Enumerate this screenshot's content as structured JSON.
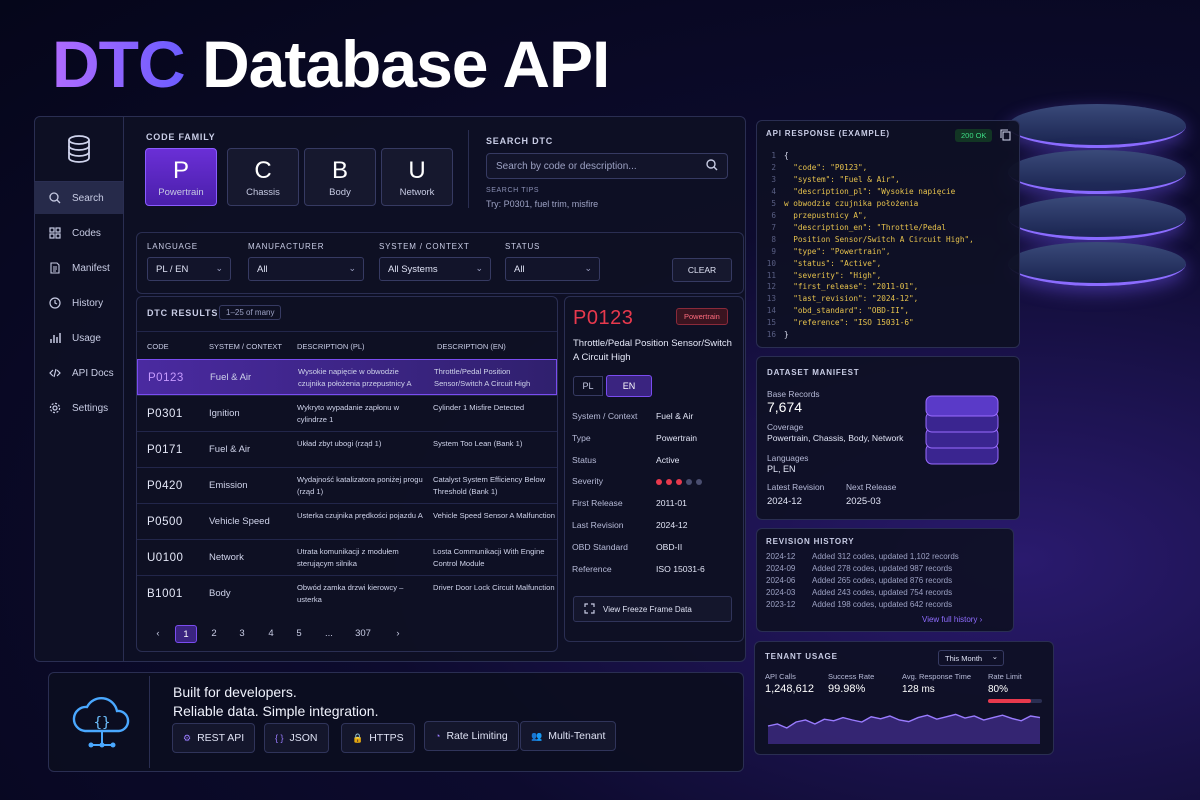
{
  "title": {
    "accent": "DTC",
    "rest": "Database API"
  },
  "colors": {
    "accent": "#7c4dff",
    "code_highlight": "#e8394d",
    "json": "#e6c24d",
    "ok": "#3ddc84"
  },
  "sidebar": {
    "logo_icon": "database-icon",
    "items": [
      {
        "label": "Search",
        "icon": "search-icon"
      },
      {
        "label": "Codes",
        "icon": "grid-icon"
      },
      {
        "label": "Manifest",
        "icon": "document-icon"
      },
      {
        "label": "History",
        "icon": "clock-icon"
      },
      {
        "label": "Usage",
        "icon": "bar-chart-icon"
      },
      {
        "label": "API Docs",
        "icon": "code-icon"
      },
      {
        "label": "Settings",
        "icon": "gear-icon"
      }
    ]
  },
  "code_family": {
    "label": "CODE FAMILY",
    "buttons": [
      {
        "letter": "P",
        "name": "Powertrain"
      },
      {
        "letter": "C",
        "name": "Chassis"
      },
      {
        "letter": "B",
        "name": "Body"
      },
      {
        "letter": "U",
        "name": "Network"
      }
    ]
  },
  "search": {
    "label": "SEARCH DTC",
    "placeholder": "Search by code or description...",
    "tips_label": "SEARCH TIPS",
    "tips": "Try: P0301, fuel trim, misfire"
  },
  "filters": {
    "language": {
      "label": "LANGUAGE",
      "value": "PL / EN"
    },
    "manufacturer": {
      "label": "MANUFACTURER",
      "value": "All"
    },
    "system": {
      "label": "SYSTEM / CONTEXT",
      "value": "All Systems"
    },
    "status": {
      "label": "STATUS",
      "value": "All"
    },
    "clear": "CLEAR"
  },
  "results": {
    "title": "DTC RESULTS",
    "count": "1–25 of many",
    "columns": [
      "CODE",
      "SYSTEM / CONTEXT",
      "DESCRIPTION (PL)",
      "DESCRIPTION (EN)"
    ],
    "rows": [
      {
        "code": "P0123",
        "system": "Fuel & Air",
        "pl": "Wysokie napięcie w obwodzie czujnika położenia przepustnicy A",
        "en": "Throttle/Pedal Position Sensor/Switch A Circuit High"
      },
      {
        "code": "P0301",
        "system": "Ignition",
        "pl": "Wykryto wypadanie zapłonu w cylindrze 1",
        "en": "Cylinder 1 Misfire Detected"
      },
      {
        "code": "P0171",
        "system": "Fuel & Air",
        "pl": "Układ zbyt ubogi (rząd 1)",
        "en": "System Too Lean (Bank 1)"
      },
      {
        "code": "P0420",
        "system": "Emission",
        "pl": "Wydajność katalizatora poniżej progu (rząd 1)",
        "en": "Catalyst System Efficiency Below Threshold (Bank 1)"
      },
      {
        "code": "P0500",
        "system": "Vehicle Speed",
        "pl": "Usterka czujnika prędkości pojazdu A",
        "en": "Vehicle Speed Sensor A Malfunction"
      },
      {
        "code": "U0100",
        "system": "Network",
        "pl": "Utrata komunikacji z modułem sterującym silnika",
        "en": "Losta Communikacji With Engine Control Module"
      },
      {
        "code": "B1001",
        "system": "Body",
        "pl": "Obwód zamka drzwi kierowcy – usterka",
        "en": "Driver Door Lock Circuit Malfunction"
      }
    ],
    "pagination": {
      "prev": "‹",
      "pages": [
        "1",
        "2",
        "3",
        "4",
        "5",
        "...",
        "307"
      ],
      "next": "›",
      "current": "1"
    }
  },
  "detail": {
    "code": "P0123",
    "badge": "Powertrain",
    "title": "Throttle/Pedal Position Sensor/Switch A Circuit High",
    "lang_tabs": [
      "PL",
      "EN"
    ],
    "fields": [
      {
        "k": "System / Context",
        "v": "Fuel & Air"
      },
      {
        "k": "Type",
        "v": "Powertrain"
      },
      {
        "k": "Status",
        "v": "Active"
      },
      {
        "k": "Severity",
        "v": ""
      },
      {
        "k": "First Release",
        "v": "2011-01"
      },
      {
        "k": "Last Revision",
        "v": "2024-12"
      },
      {
        "k": "OBD Standard",
        "v": "OBD-II"
      },
      {
        "k": "Reference",
        "v": "ISO 15031-6"
      }
    ],
    "severity_level": 3,
    "severity_max": 5,
    "freeze_button": "View Freeze Frame Data"
  },
  "api_response": {
    "label": "API RESPONSE (EXAMPLE)",
    "status": "200 OK",
    "lines": [
      "{",
      "  \"code\": \"P0123\",",
      "  \"system\": \"Fuel & Air\",",
      "  \"description_pl\": \"Wysokie napięcie",
      "w obwodzie czujnika położenia",
      "  przepustnicy A\",",
      "  \"description_en\": \"Throttle/Pedal",
      "  Position Sensor/Switch A Circuit High\",",
      "  \"type\": \"Powertrain\",",
      "  \"status\": \"Active\",",
      "  \"severity\": \"High\",",
      "  \"first_release\": \"2011-01\",",
      "  \"last_revision\": \"2024-12\",",
      "  \"obd_standard\": \"OBD-II\",",
      "  \"reference\": \"ISO 15031-6\"",
      "}"
    ]
  },
  "manifest": {
    "label": "DATASET MANIFEST",
    "base_records_label": "Base Records",
    "base_records": "7,674",
    "coverage_label": "Coverage",
    "coverage": "Powertrain, Chassis, Body, Network",
    "languages_label": "Languages",
    "languages": "PL, EN",
    "latest_label": "Latest Revision",
    "latest": "2024-12",
    "next_label": "Next Release",
    "next": "2025-03"
  },
  "revision_history": {
    "label": "REVISION HISTORY",
    "items": [
      {
        "date": "2024-12",
        "text": "Added 312 codes, updated 1,102 records"
      },
      {
        "date": "2024-09",
        "text": "Added 278 codes, updated 987 records"
      },
      {
        "date": "2024-06",
        "text": "Added 265 codes, updated 876 records"
      },
      {
        "date": "2024-03",
        "text": "Added 243 codes, updated 754 records"
      },
      {
        "date": "2023-12",
        "text": "Added 198 codes, updated 642 records"
      }
    ],
    "link": "View full history"
  },
  "tenant_usage": {
    "label": "TENANT USAGE",
    "period": "This Month",
    "api_calls_label": "API Calls",
    "api_calls": "1,248,612",
    "success_label": "Success Rate",
    "success": "99.98%",
    "response_label": "Avg. Response Time",
    "response": "128 ms",
    "rate_label": "Rate Limit",
    "rate": "80%",
    "rate_fraction": 0.8,
    "spark": [
      0.45,
      0.5,
      0.4,
      0.55,
      0.6,
      0.5,
      0.62,
      0.58,
      0.66,
      0.6,
      0.55,
      0.68,
      0.63,
      0.7,
      0.6,
      0.56,
      0.66,
      0.72,
      0.62,
      0.68,
      0.74,
      0.65,
      0.7,
      0.6,
      0.66,
      0.72,
      0.64,
      0.58,
      0.7,
      0.66
    ]
  },
  "footer": {
    "line1": "Built for developers.",
    "line2": "Reliable data. Simple integration.",
    "chips": [
      {
        "label": "REST API",
        "icon": "api-icon"
      },
      {
        "label": "JSON",
        "icon": "braces-icon"
      },
      {
        "label": "HTTPS",
        "icon": "lock-icon"
      },
      {
        "label": "Rate Limiting",
        "icon": "gauge-icon"
      },
      {
        "label": "Multi-Tenant",
        "icon": "users-icon"
      }
    ]
  }
}
